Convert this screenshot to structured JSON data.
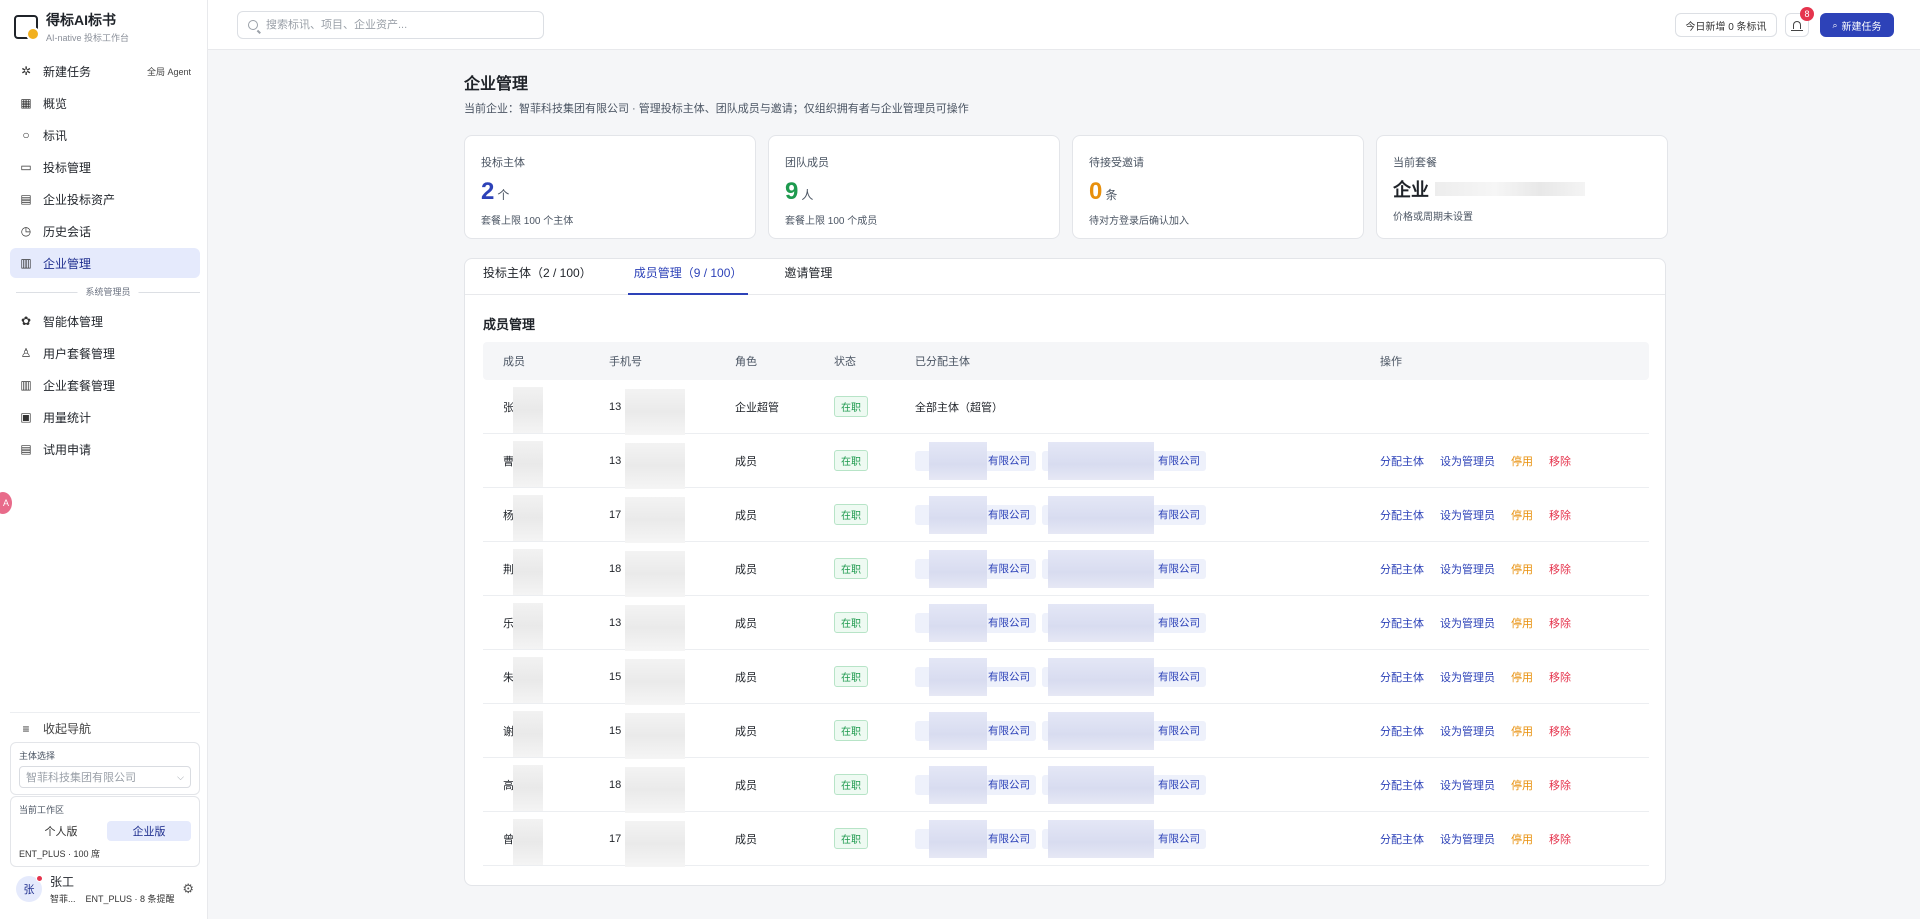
{
  "brand": {
    "name": "得标AI标书",
    "subtitle": "AI-native 投标工作台"
  },
  "nav": {
    "items": [
      {
        "label": "新建任务",
        "icon": "sparkle-icon",
        "badge": "全局 Agent",
        "active": false
      },
      {
        "label": "概览",
        "icon": "grid-icon",
        "badge": "",
        "active": false
      },
      {
        "label": "标讯",
        "icon": "search-icon",
        "badge": "",
        "active": false
      },
      {
        "label": "投标管理",
        "icon": "folder-icon",
        "badge": "",
        "active": false
      },
      {
        "label": "企业投标资产",
        "icon": "document-icon",
        "badge": "",
        "active": false
      },
      {
        "label": "历史会话",
        "icon": "clock-icon",
        "badge": "",
        "active": false
      },
      {
        "label": "企业管理",
        "icon": "building-icon",
        "badge": "",
        "active": true
      }
    ],
    "section_label": "系统管理员",
    "admin_items": [
      {
        "label": "智能体管理",
        "icon": "gear-icon"
      },
      {
        "label": "用户套餐管理",
        "icon": "user-icon"
      },
      {
        "label": "企业套餐管理",
        "icon": "building-icon"
      },
      {
        "label": "用量统计",
        "icon": "chart-icon"
      },
      {
        "label": "试用申请",
        "icon": "clipboard-icon"
      }
    ],
    "collapse_label": "收起导航"
  },
  "subject_panel": {
    "label": "主体选择",
    "placeholder": "智菲科技集团有限公司"
  },
  "workspace_panel": {
    "label": "当前工作区",
    "options": [
      "个人版",
      "企业版"
    ],
    "selected": "企业版",
    "footer": "ENT_PLUS · 100 席"
  },
  "user": {
    "avatar": "张",
    "name": "张工",
    "sub": "智菲...    ENT_PLUS · 8 条提醒"
  },
  "topbar": {
    "search_placeholder": "搜索标讯、项目、企业资产...",
    "today_label": "今日新增 0 条标讯",
    "notification_count": "8",
    "new_task_label": "新建任务"
  },
  "page": {
    "title": "企业管理",
    "description": "当前企业：智菲科技集团有限公司 · 管理投标主体、团队成员与邀请；仅组织拥有者与企业管理员可操作"
  },
  "stats": [
    {
      "label": "投标主体",
      "value": "2",
      "unit": "个",
      "hint": "套餐上限 100 个主体",
      "color": "#2d42b8"
    },
    {
      "label": "团队成员",
      "value": "9",
      "unit": "人",
      "hint": "套餐上限 100 个成员",
      "color": "#1e9a4e"
    },
    {
      "label": "待接受邀请",
      "value": "0",
      "unit": "条",
      "hint": "待对方登录后确认加入",
      "color": "#e8900c"
    }
  ],
  "plan": {
    "label": "当前套餐",
    "name": "企业",
    "hint": "价格或周期未设置"
  },
  "tabs": [
    {
      "label": "投标主体（2 / 100）",
      "active": false
    },
    {
      "label": "成员管理（9 / 100）",
      "active": true
    },
    {
      "label": "邀请管理",
      "active": false
    }
  ],
  "members": {
    "section_title": "成员管理",
    "columns": [
      "成员",
      "手机号",
      "角色",
      "状态",
      "已分配主体",
      "操作"
    ],
    "rows": [
      {
        "member": "张",
        "phone": "13",
        "role": "企业超管",
        "status": "在职",
        "assigned_text": "全部主体（超管）",
        "tags": [],
        "ops": []
      },
      {
        "member": "曹",
        "phone": "13",
        "role": "成员",
        "status": "在职",
        "assigned_text": "",
        "tags": [
          "有限公司",
          "有限公司"
        ],
        "ops": [
          "分配主体",
          "设为管理员",
          "停用",
          "移除"
        ]
      },
      {
        "member": "杨",
        "phone": "17",
        "role": "成员",
        "status": "在职",
        "assigned_text": "",
        "tags": [
          "有限公司",
          "有限公司"
        ],
        "ops": [
          "分配主体",
          "设为管理员",
          "停用",
          "移除"
        ]
      },
      {
        "member": "荆",
        "phone": "18",
        "role": "成员",
        "status": "在职",
        "assigned_text": "",
        "tags": [
          "有限公司",
          "有限公司"
        ],
        "ops": [
          "分配主体",
          "设为管理员",
          "停用",
          "移除"
        ]
      },
      {
        "member": "乐",
        "phone": "13",
        "role": "成员",
        "status": "在职",
        "assigned_text": "",
        "tags": [
          "有限公司",
          "有限公司"
        ],
        "ops": [
          "分配主体",
          "设为管理员",
          "停用",
          "移除"
        ]
      },
      {
        "member": "朱",
        "phone": "15",
        "role": "成员",
        "status": "在职",
        "assigned_text": "",
        "tags": [
          "有限公司",
          "有限公司"
        ],
        "ops": [
          "分配主体",
          "设为管理员",
          "停用",
          "移除"
        ]
      },
      {
        "member": "谢",
        "phone": "15",
        "role": "成员",
        "status": "在职",
        "assigned_text": "",
        "tags": [
          "有限公司",
          "有限公司"
        ],
        "ops": [
          "分配主体",
          "设为管理员",
          "停用",
          "移除"
        ]
      },
      {
        "member": "高",
        "phone": "18",
        "role": "成员",
        "status": "在职",
        "assigned_text": "",
        "tags": [
          "有限公司",
          "有限公司"
        ],
        "ops": [
          "分配主体",
          "设为管理员",
          "停用",
          "移除"
        ]
      },
      {
        "member": "曾",
        "phone": "17",
        "role": "成员",
        "status": "在职",
        "assigned_text": "",
        "tags": [
          "有限公司",
          "有限公司"
        ],
        "ops": [
          "分配主体",
          "设为管理员",
          "停用",
          "移除"
        ]
      }
    ]
  }
}
